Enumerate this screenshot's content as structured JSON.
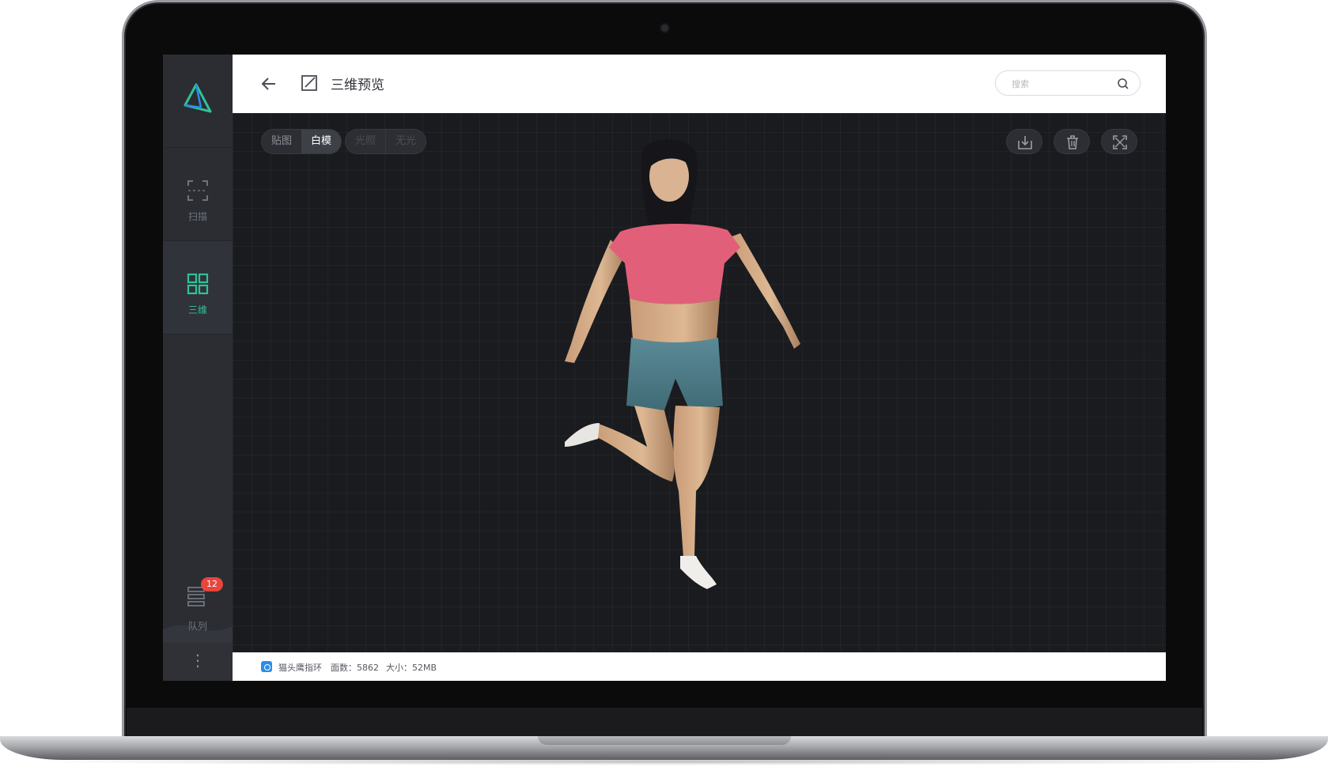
{
  "app": {
    "header": {
      "title": "三维预览",
      "search_placeholder": "搜索"
    },
    "sidebar": {
      "items": [
        {
          "label": "扫描",
          "icon": "scan-frame-icon"
        },
        {
          "label": "三维",
          "icon": "grid-icon",
          "active": true
        },
        {
          "label": "队列",
          "icon": "queue-icon",
          "badge": "12"
        }
      ],
      "accent_color": "#2fc29a",
      "badge_color": "#e8453c"
    },
    "viewport": {
      "texture_toggle": {
        "options": [
          "贴图",
          "白模"
        ],
        "selected": "白模"
      },
      "light_toggle": {
        "options": [
          "光照",
          "无光"
        ],
        "disabled": true
      },
      "tools": [
        "download-icon",
        "trash-icon",
        "fullscreen-icon"
      ]
    },
    "footer": {
      "model_name": "猫头鹰指环",
      "faces_text": "面数：5862",
      "size_text": "大小：52MB"
    }
  }
}
